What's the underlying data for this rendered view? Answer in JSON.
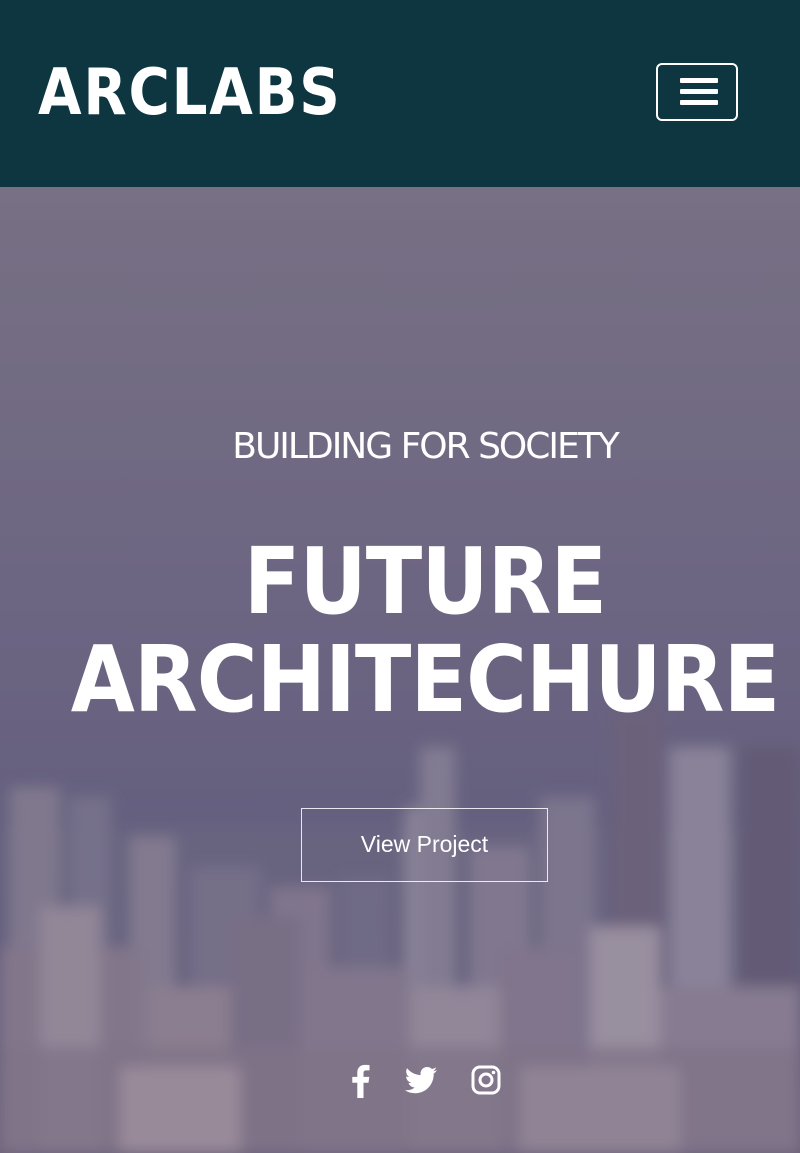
{
  "header": {
    "brand": "ARCLABS",
    "menu_label": "menu",
    "background_color": "#0d3641"
  },
  "hero": {
    "eyebrow": "BUILDING FOR SOCIETY",
    "headline_line1": "FUTURE",
    "headline_line2": "ARCHITECHURE",
    "cta_label": "View Project",
    "overlay_color": "#6e6480"
  },
  "social": {
    "icons": [
      "facebook-icon",
      "twitter-icon",
      "instagram-icon"
    ]
  }
}
